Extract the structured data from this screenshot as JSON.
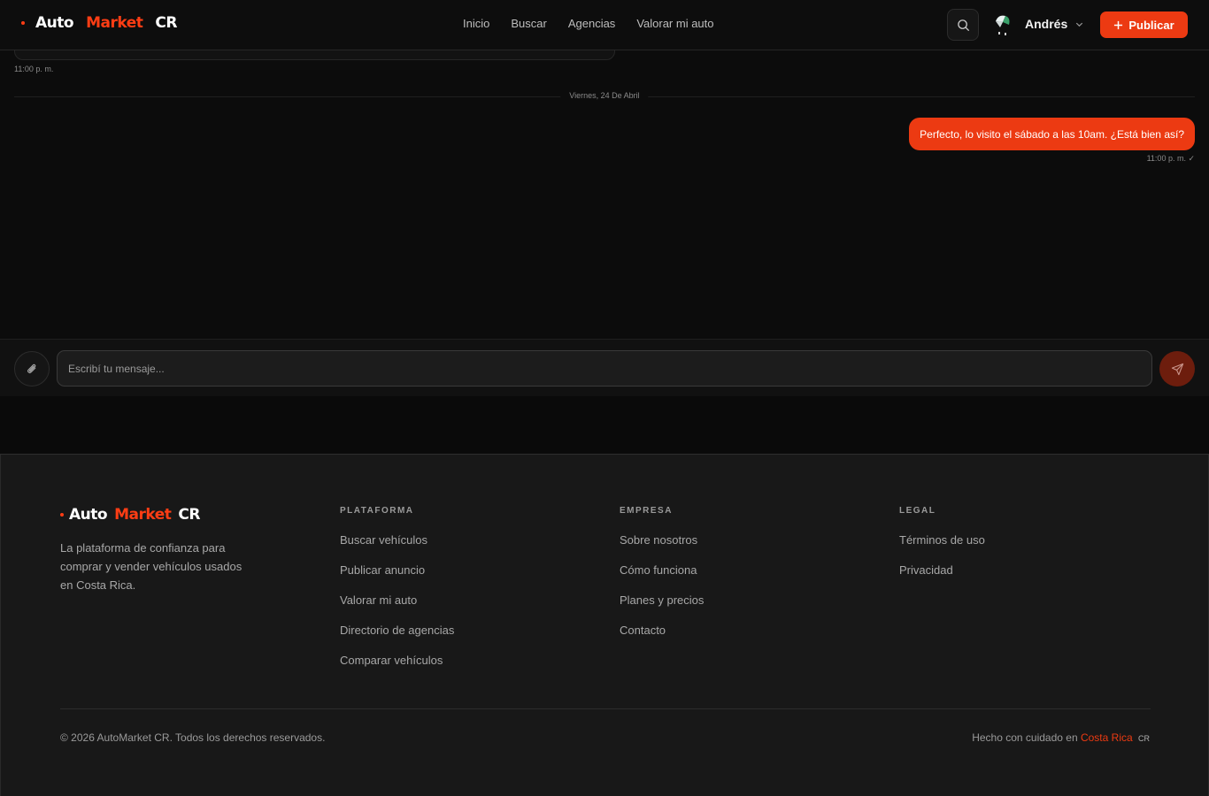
{
  "brand": {
    "part1": "Auto",
    "part2": "Market",
    "part3": "CR",
    "accent_color": "#ec3a12"
  },
  "nav": {
    "items": [
      "Inicio",
      "Buscar",
      "Agencias",
      "Valorar mi auto"
    ]
  },
  "header": {
    "search_icon": "search-icon",
    "user_name": "Andrés",
    "publish_label": "Publicar"
  },
  "chat": {
    "previous_message_time": "11:00 p. m.",
    "date_separator": "Viernes, 24 De Abril",
    "messages": [
      {
        "text": "Perfecto, lo visito el sábado a las 10am. ¿Está bien así?",
        "time": "11:00 p. m. ✓",
        "outgoing": true
      }
    ]
  },
  "composer": {
    "placeholder": "Escribí tu mensaje...",
    "value": ""
  },
  "footer": {
    "description": "La plataforma de confianza para comprar y vender vehículos usados en Costa Rica.",
    "columns": [
      {
        "title": "PLATAFORMA",
        "links": [
          "Buscar vehículos",
          "Publicar anuncio",
          "Valorar mi auto",
          "Directorio de agencias",
          "Comparar vehículos"
        ]
      },
      {
        "title": "EMPRESA",
        "links": [
          "Sobre nosotros",
          "Cómo funciona",
          "Planes y precios",
          "Contacto"
        ]
      },
      {
        "title": "LEGAL",
        "links": [
          "Términos de uso",
          "Privacidad"
        ]
      }
    ],
    "copyright": "© 2026 AutoMarket CR. Todos los derechos reservados.",
    "made_prefix": "Hecho con cuidado en",
    "made_country": "Costa Rica",
    "made_flag": "CR"
  }
}
